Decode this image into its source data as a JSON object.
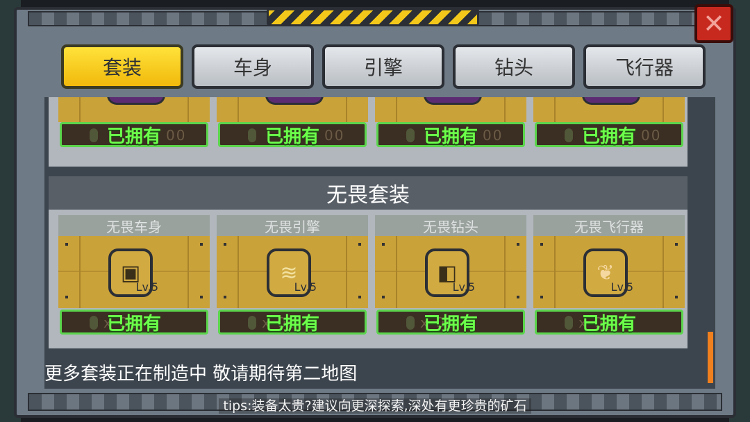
{
  "tabs": [
    {
      "label": "套装",
      "active": true
    },
    {
      "label": "车身",
      "active": false
    },
    {
      "label": "引擎",
      "active": false
    },
    {
      "label": "钻头",
      "active": false
    },
    {
      "label": "飞行器",
      "active": false
    }
  ],
  "close_icon": "close-icon",
  "prev_section": {
    "items": [
      {
        "status": "已拥有",
        "ghost_price": "00"
      },
      {
        "status": "已拥有",
        "ghost_price": "00"
      },
      {
        "status": "已拥有",
        "ghost_price": "00"
      },
      {
        "status": "已拥有",
        "ghost_price": "00"
      }
    ]
  },
  "section": {
    "title": "无畏套装",
    "items": [
      {
        "name": "无畏车身",
        "level": "Lv.5",
        "status": "已拥有",
        "ghost_price": "x    00",
        "icon": "car-body-icon"
      },
      {
        "name": "无畏引擎",
        "level": "Lv.5",
        "status": "已拥有",
        "ghost_price": "x    00",
        "icon": "engine-icon"
      },
      {
        "name": "无畏钻头",
        "level": "Lv.5",
        "status": "已拥有",
        "ghost_price": "x    00",
        "icon": "drill-icon"
      },
      {
        "name": "无畏飞行器",
        "level": "Lv.5",
        "status": "已拥有",
        "ghost_price": "x    00",
        "icon": "wing-icon"
      }
    ]
  },
  "footer_message": "更多套装正在制造中   敬请期待第二地图",
  "tips": "tips:装备太贵?建议向更深探索,深处有更珍贵的矿石",
  "colors": {
    "accent_tab": "#f1b90b",
    "owned_text": "#6bff4a",
    "owned_border": "#5bd54c",
    "close": "#c8291f",
    "scrollbar": "#f07f1e"
  }
}
